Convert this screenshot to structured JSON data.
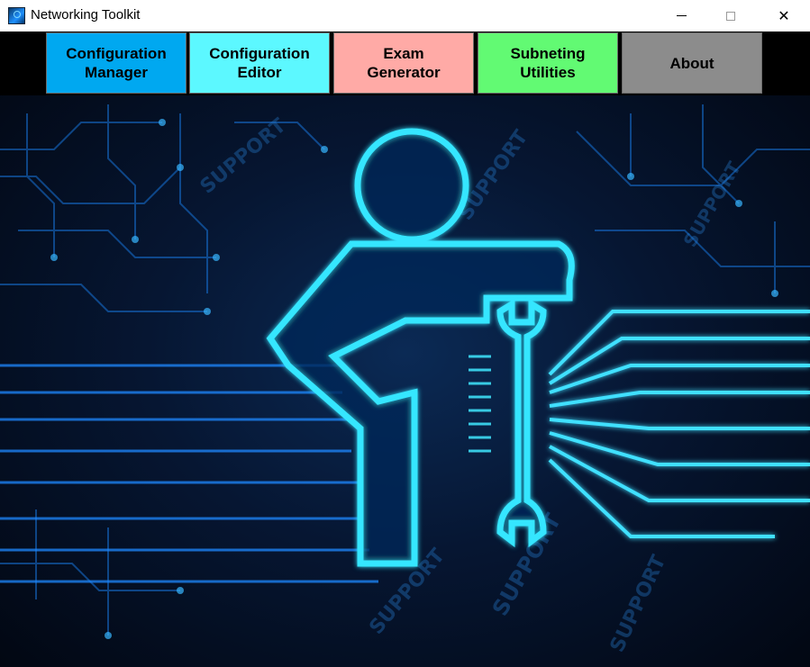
{
  "window": {
    "title": "Networking Toolkit"
  },
  "titlebar_icons": {
    "app": "app-logo-icon",
    "minimize": "minimize-icon",
    "maximize": "maximize-icon",
    "close": "close-icon"
  },
  "nav": {
    "buttons": [
      {
        "label": "Configuration\nManager",
        "color": "#00a8f0"
      },
      {
        "label": "Configuration\nEditor",
        "color": "#5cf8ff"
      },
      {
        "label": "Exam\nGenerator",
        "color": "#ffaaa6"
      },
      {
        "label": "Subneting\nUtilities",
        "color": "#62fa73"
      },
      {
        "label": "About",
        "color": "#8c8c8c"
      }
    ]
  },
  "hero": {
    "support_text": "SUPPORT",
    "accent": "#27d3ff"
  }
}
